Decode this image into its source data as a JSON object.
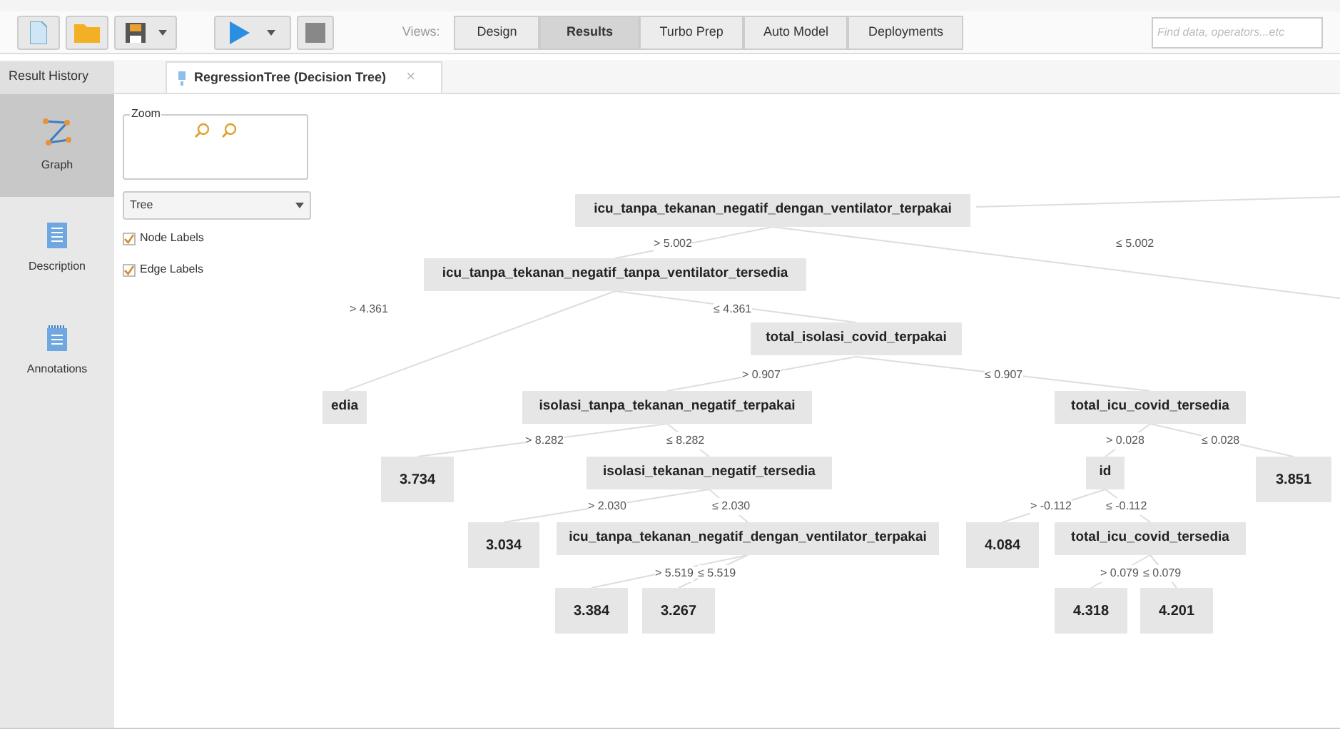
{
  "toolbar": {
    "views_label": "Views:",
    "views": [
      {
        "label": "Design",
        "selected": false
      },
      {
        "label": "Results",
        "selected": true
      },
      {
        "label": "Turbo Prep",
        "selected": false
      },
      {
        "label": "Auto Model",
        "selected": false
      },
      {
        "label": "Deployments",
        "selected": false
      }
    ],
    "search": {
      "placeholder": "Find data, operators...etc"
    }
  },
  "panel_header": {
    "label": "Result History"
  },
  "tabs": [
    {
      "label": "RegressionTree (Decision Tree)",
      "selected": true,
      "close": "×"
    }
  ],
  "sidebar": {
    "items": [
      {
        "label": "Graph",
        "kind": "graph",
        "selected": true
      },
      {
        "label": "Description",
        "kind": "description",
        "selected": false
      },
      {
        "label": "Annotations",
        "kind": "annotations",
        "selected": false
      }
    ]
  },
  "controls": {
    "zoom_label": "Zoom",
    "layout": "Tree",
    "options": [
      {
        "label": "Node Labels",
        "checked": true
      },
      {
        "label": "Edge Labels",
        "checked": true
      }
    ]
  },
  "tree": [
    {
      "label": "icu_tanpa_tekanan_negatif_dengan_ventilator_terpakai",
      "kind": "split",
      "children": [
        {
          "condition": "> 5.002",
          "label": "icu_tanpa_tekanan_negatif_tanpa_ventilator_tersedia",
          "kind": "split",
          "children": [
            {
              "condition": "> 4.361",
              "label": "edia",
              "kind": "split"
            },
            {
              "condition": "≤ 4.361",
              "label": "total_isolasi_covid_terpakai",
              "kind": "split",
              "children": [
                {
                  "condition": "> 0.907",
                  "label": "isolasi_tanpa_tekanan_negatif_terpakai",
                  "kind": "split",
                  "children": [
                    {
                      "condition": "> 8.282",
                      "label": "3.734",
                      "kind": "leaf"
                    },
                    {
                      "condition": "≤ 8.282",
                      "label": "isolasi_tekanan_negatif_tersedia",
                      "kind": "split",
                      "children": [
                        {
                          "condition": "> 2.030",
                          "label": "3.034",
                          "kind": "leaf"
                        },
                        {
                          "condition": "≤ 2.030",
                          "label": "icu_tanpa_tekanan_negatif_dengan_ventilator_terpakai",
                          "kind": "split",
                          "children": [
                            {
                              "condition": "> 5.519",
                              "label": "3.384",
                              "kind": "leaf"
                            },
                            {
                              "condition": "≤ 5.519",
                              "label": "3.267",
                              "kind": "leaf"
                            }
                          ]
                        }
                      ]
                    }
                  ]
                },
                {
                  "condition": "≤ 0.907",
                  "label": "total_icu_covid_tersedia",
                  "kind": "split",
                  "children": [
                    {
                      "condition": "> 0.028",
                      "label": "id",
                      "kind": "split",
                      "children": [
                        {
                          "condition": "> -0.112",
                          "label": "4.084",
                          "kind": "leaf"
                        },
                        {
                          "condition": "≤ -0.112",
                          "label": "total_icu_covid_tersedia",
                          "kind": "split",
                          "children": [
                            {
                              "condition": "> 0.079",
                              "label": "4.318",
                              "kind": "leaf"
                            },
                            {
                              "condition": "≤ 0.079",
                              "label": "4.201",
                              "kind": "leaf"
                            }
                          ]
                        }
                      ]
                    },
                    {
                      "condition": "≤ 0.028",
                      "label": "3.851",
                      "kind": "leaf"
                    }
                  ]
                }
              ]
            }
          ]
        },
        {
          "condition": "≤ 5.002"
        }
      ]
    }
  ]
}
